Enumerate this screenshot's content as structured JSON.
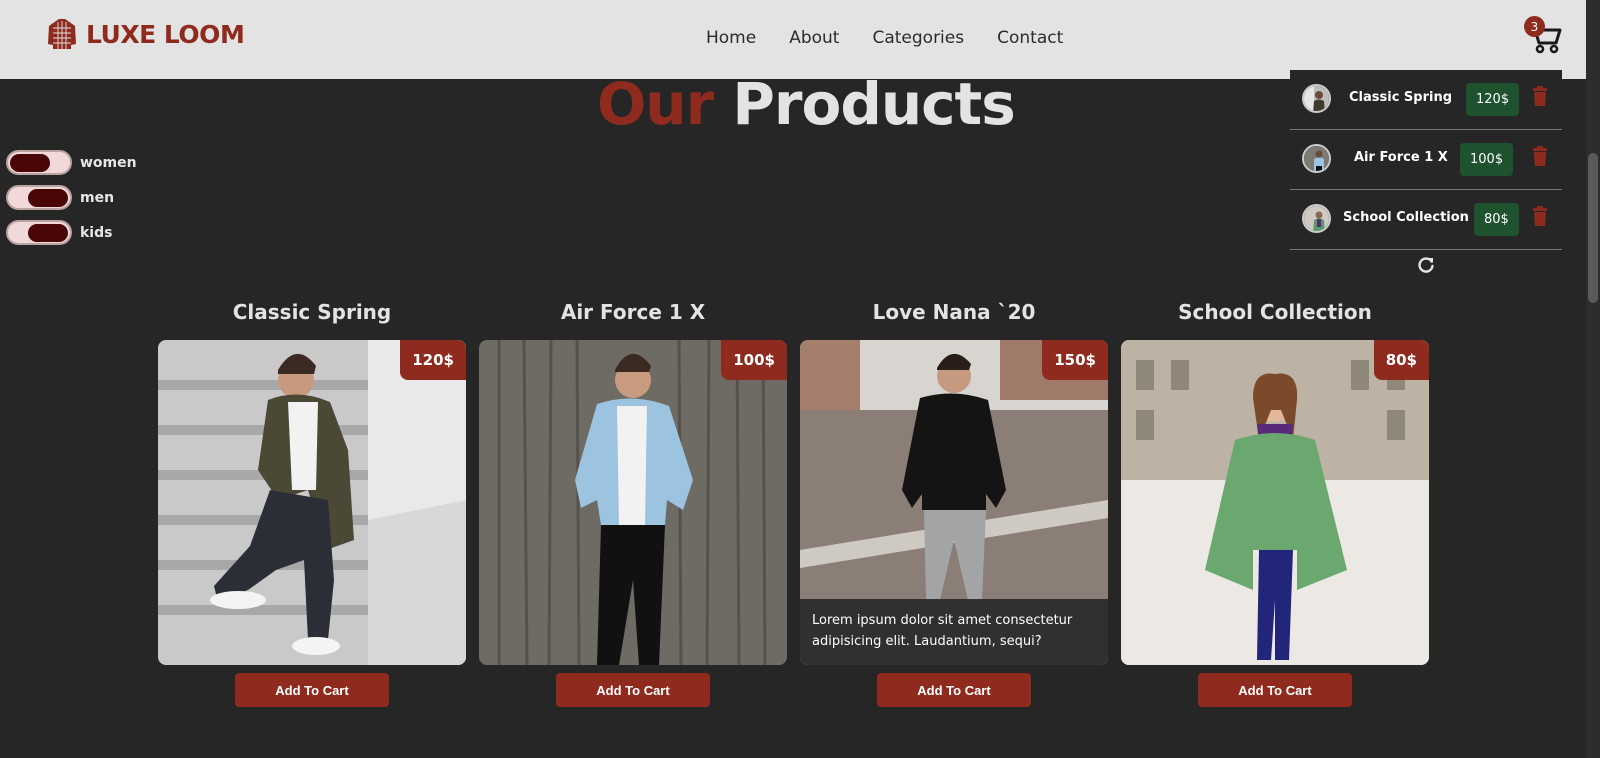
{
  "brand": {
    "name": "LUXE LOOM",
    "logo_icon": "sweater-icon"
  },
  "nav": {
    "links": [
      {
        "label": "Home"
      },
      {
        "label": "About"
      },
      {
        "label": "Categories"
      },
      {
        "label": "Contact"
      }
    ]
  },
  "cart": {
    "icon": "cart-icon",
    "count": "3",
    "items": [
      {
        "name": "Classic Spring",
        "price": "120$"
      },
      {
        "name": "Air Force 1 X",
        "price": "100$"
      },
      {
        "name": "School Collection",
        "price": "80$"
      }
    ],
    "refresh_icon": "refresh-icon"
  },
  "heading": {
    "accent": "Our",
    "main": "Products"
  },
  "filters": [
    {
      "label": "women",
      "state": "off"
    },
    {
      "label": "men",
      "state": "on"
    },
    {
      "label": "kids",
      "state": "on"
    }
  ],
  "products": [
    {
      "title": "Classic Spring",
      "price": "120$",
      "button": "Add To Cart"
    },
    {
      "title": "Air Force 1 X",
      "price": "100$",
      "button": "Add To Cart"
    },
    {
      "title": "Love Nana `20",
      "price": "150$",
      "button": "Add To Cart",
      "description": "Lorem ipsum dolor sit amet consectetur adipisicing elit. Laudantium, sequi?"
    },
    {
      "title": "School Collection",
      "price": "80$",
      "button": "Add To Cart"
    }
  ],
  "colors": {
    "accent": "#8f2b1e",
    "price_green": "#1f5330",
    "background": "#262626",
    "header": "#e3e3e3"
  }
}
